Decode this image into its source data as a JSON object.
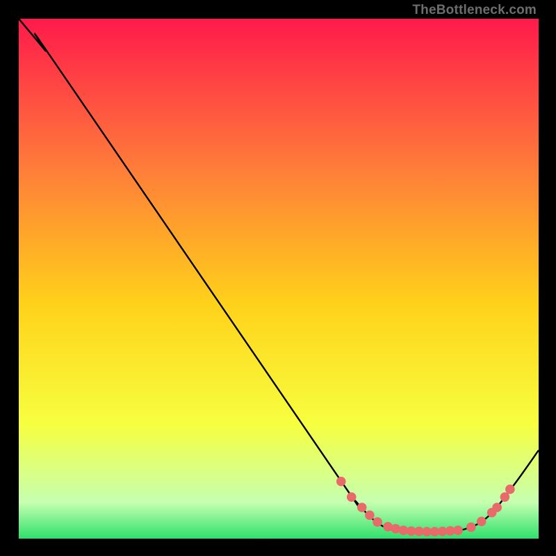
{
  "watermark": "TheBottleneck.com",
  "colors": {
    "background": "#000000",
    "curve_stroke": "#000000",
    "marker_fill": "#e86a6a",
    "marker_stroke": "#cf4e4e",
    "gradient_top": "#ff1a4b",
    "gradient_upper_mid": "#ff7a3a",
    "gradient_mid": "#ffd21a",
    "gradient_lower_mid": "#f7ff3f",
    "gradient_pale_green": "#c6ffb0",
    "gradient_green": "#2fe06c"
  },
  "chart_data": {
    "type": "line",
    "title": "",
    "xlabel": "",
    "ylabel": "",
    "xlim": [
      0,
      100
    ],
    "ylim": [
      0,
      100
    ],
    "curve": [
      {
        "x": 0,
        "y": 100
      },
      {
        "x": 5,
        "y": 94
      },
      {
        "x": 8,
        "y": 90
      },
      {
        "x": 60,
        "y": 14
      },
      {
        "x": 65,
        "y": 7
      },
      {
        "x": 70,
        "y": 2.4
      },
      {
        "x": 75,
        "y": 1.4
      },
      {
        "x": 80,
        "y": 1.3
      },
      {
        "x": 85,
        "y": 1.6
      },
      {
        "x": 90,
        "y": 4
      },
      {
        "x": 95,
        "y": 10
      },
      {
        "x": 100,
        "y": 17
      }
    ],
    "markers": [
      {
        "x": 62,
        "y": 11
      },
      {
        "x": 64,
        "y": 8
      },
      {
        "x": 66,
        "y": 6
      },
      {
        "x": 67.5,
        "y": 4.5
      },
      {
        "x": 69,
        "y": 3.2
      },
      {
        "x": 71,
        "y": 2.3
      },
      {
        "x": 72.5,
        "y": 1.9
      },
      {
        "x": 74,
        "y": 1.6
      },
      {
        "x": 75.5,
        "y": 1.45
      },
      {
        "x": 77,
        "y": 1.4
      },
      {
        "x": 78.5,
        "y": 1.35
      },
      {
        "x": 80,
        "y": 1.35
      },
      {
        "x": 81.5,
        "y": 1.4
      },
      {
        "x": 83,
        "y": 1.5
      },
      {
        "x": 84.5,
        "y": 1.6
      },
      {
        "x": 87,
        "y": 2.2
      },
      {
        "x": 89,
        "y": 3.3
      },
      {
        "x": 91,
        "y": 5
      },
      {
        "x": 92,
        "y": 6
      },
      {
        "x": 93.5,
        "y": 8
      },
      {
        "x": 94.5,
        "y": 9.5
      }
    ]
  }
}
